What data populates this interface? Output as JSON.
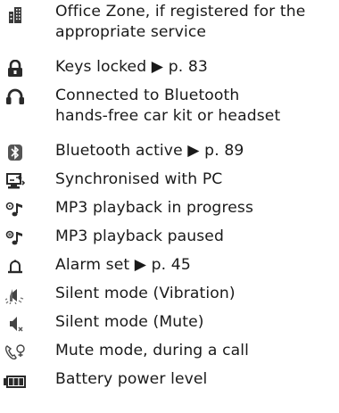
{
  "items": [
    {
      "icon": "office-zone-icon",
      "lines": [
        "Office Zone, if registered for the",
        "appropriate service"
      ]
    },
    {
      "icon": "key-lock-icon",
      "lines": [
        "Keys locked ▶ p. 83"
      ]
    },
    {
      "icon": "headset-icon",
      "lines": [
        "Connected to Bluetooth",
        "hands-free car kit or headset"
      ]
    },
    {
      "icon": "bluetooth-icon",
      "lines": [
        "Bluetooth active ▶ p. 89"
      ]
    },
    {
      "icon": "pc-sync-icon",
      "lines": [
        "Synchronised with PC"
      ]
    },
    {
      "icon": "mp3-play-icon",
      "lines": [
        "MP3 playback in progress"
      ]
    },
    {
      "icon": "mp3-pause-icon",
      "lines": [
        "MP3 playback paused"
      ]
    },
    {
      "icon": "alarm-bell-icon",
      "lines": [
        "Alarm set ▶ p. 45"
      ]
    },
    {
      "icon": "vibration-icon",
      "lines": [
        "Silent mode (Vibration)"
      ]
    },
    {
      "icon": "mute-speaker-icon",
      "lines": [
        "Silent mode (Mute)"
      ]
    },
    {
      "icon": "call-mute-icon",
      "lines": [
        "Mute mode, during a call"
      ]
    },
    {
      "icon": "battery-icon",
      "lines": [
        "Battery power level"
      ]
    }
  ]
}
